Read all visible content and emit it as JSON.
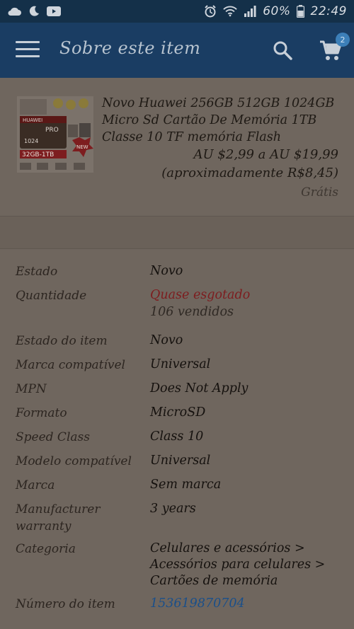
{
  "status_bar": {
    "left_icons": [
      "cloud-icon",
      "moon-icon",
      "youtube-icon"
    ],
    "right_icons": [
      "alarm-icon",
      "wifi-icon",
      "signal-icon",
      "battery-icon"
    ],
    "battery": "60%",
    "time": "22:49"
  },
  "app_bar": {
    "title": "Sobre este item",
    "cart_count": "2"
  },
  "product": {
    "title": "Novo Huawei 256GB 512GB 1024GB Micro Sd Cartão De Memória 1TB Classe 10 TF memória Flash",
    "price": "AU $2,99 a AU $19,99",
    "approx": "(aproximadamente R$8,45)",
    "shipping": "Grátis",
    "image_texts": [
      "HUAWEI",
      "PRO",
      "1024",
      "32GB-1TB",
      "NEW"
    ]
  },
  "specs": [
    {
      "label": "Estado",
      "value": "Novo"
    },
    {
      "label": "Quantidade",
      "value": "Quase esgotado",
      "sub": "106 vendidos"
    },
    {
      "label": "Estado do item",
      "value": "Novo"
    },
    {
      "label": "Marca compatível",
      "value": "Universal"
    },
    {
      "label": "MPN",
      "value": "Does Not Apply"
    },
    {
      "label": "Formato",
      "value": "MicroSD"
    },
    {
      "label": "Speed Class",
      "value": "Class 10"
    },
    {
      "label": "Modelo compatível",
      "value": "Universal"
    },
    {
      "label": "Marca",
      "value": "Sem marca"
    },
    {
      "label": "Manufacturer warranty",
      "value": "3 years"
    },
    {
      "label": "Categoria",
      "value": "Celulares e acessórios > Acessórios para celulares > Cartões de memória"
    },
    {
      "label": "Número do item",
      "value": "153619870704"
    }
  ],
  "colors": {
    "status_bar": "#143049",
    "app_bar": "#1a3d63",
    "background": "#6f665e",
    "warning": "#7d1d1f",
    "link": "#1a4f8a"
  }
}
